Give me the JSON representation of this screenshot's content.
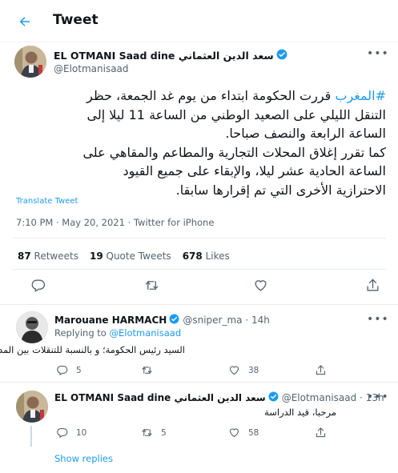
{
  "header": {
    "title": "Tweet",
    "back_icon": "arrow-left-icon"
  },
  "tweet": {
    "author_name": "EL OTMANI Saad dine سعد الدين العثماني",
    "handle": "@Elotmanisaad",
    "body_lines": [
      {
        "hashtag": "#المغرب",
        "text": " قررت الحكومة ابتداء من يوم غد الجمعة، حظر"
      },
      {
        "hashtag": "",
        "text": "التنقل الليلي على الصعيد الوطني من الساعة 11 ليلا إلى"
      },
      {
        "hashtag": "",
        "text": "الساعة الرابعة والنصف صباحا."
      },
      {
        "hashtag": "",
        "text": "كما تقرر إغلاق المحلات التجارية والمطاعم والمقاهي على"
      },
      {
        "hashtag": "",
        "text": "الساعة الحادية عشر ليلا، والإبقاء على جميع القيود"
      },
      {
        "hashtag": "",
        "text": "الاحترازية الأخرى التي تم إقرارها سابقا."
      }
    ],
    "translate_label": "Translate Tweet",
    "meta": "7:10 PM · May 20, 2021 · Twitter for iPhone",
    "stats": {
      "retweets_count": "87",
      "retweets_label": "Retweets",
      "quotes_count": "19",
      "quotes_label": "Quote Tweets",
      "likes_count": "678",
      "likes_label": "Likes"
    }
  },
  "replies": [
    {
      "author_name": "Marouane HARMACH",
      "handle_time": "@sniper_ma · 14h",
      "replying_prefix": "Replying to ",
      "replying_to": "@Elotmanisaad",
      "text": "السيد رئيس الحكومة؛ و بالنسبة للتنقلات بين المدن ؟",
      "reply_count": "5",
      "retweet_count": "",
      "like_count": "38"
    },
    {
      "author_name": "EL OTMANI Saad dine سعد الدين العثماني",
      "handle_time": "@Elotmanisaad · 13h",
      "text": "مرحبا، قيد الدراسة",
      "reply_count": "10",
      "retweet_count": "5",
      "like_count": "58"
    }
  ],
  "show_replies_label": "Show replies",
  "colors": {
    "accent": "#1d9bf0",
    "secondary_text": "#536471",
    "border": "#e6ecf0"
  }
}
